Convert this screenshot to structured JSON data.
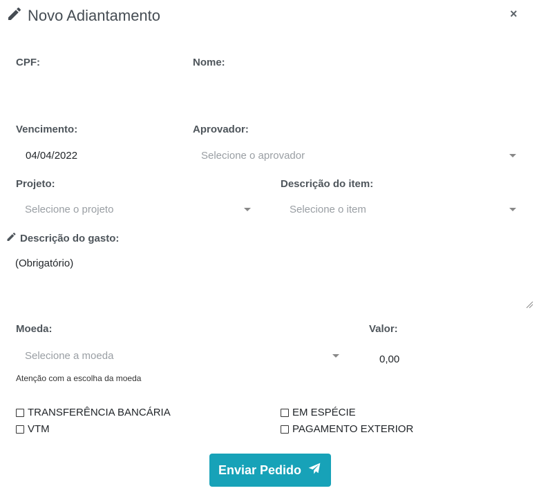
{
  "modal": {
    "title": "Novo Adiantamento",
    "close_label": "×"
  },
  "form": {
    "cpf_label": "CPF:",
    "nome_label": "Nome:",
    "vencimento_label": "Vencimento:",
    "vencimento_value": "04/04/2022",
    "aprovador_label": "Aprovador:",
    "aprovador_placeholder": "Selecione o aprovador",
    "projeto_label": "Projeto:",
    "projeto_placeholder": "Selecione o projeto",
    "item_label": "Descrição do item:",
    "item_placeholder": "Selecione o item",
    "gasto_label": "Descrição do gasto:",
    "gasto_placeholder": "(Obrigatório)",
    "moeda_label": "Moeda:",
    "moeda_placeholder": "Selecione a moeda",
    "moeda_hint": "Atenção com a escolha da moeda",
    "valor_label": "Valor:",
    "valor_value": "0,00"
  },
  "payment_options": [
    {
      "label": "TRANSFERÊNCIA BANCÁRIA",
      "checked": false
    },
    {
      "label": "EM ESPÉCIE",
      "checked": false
    },
    {
      "label": "VTM",
      "checked": false
    },
    {
      "label": "PAGAMENTO EXTERIOR",
      "checked": false
    }
  ],
  "submit": {
    "label": "Enviar Pedido"
  },
  "icons": {
    "title": "pencil-icon",
    "gasto": "pencil-icon",
    "submit": "paper-plane-icon",
    "dropdown": "caret-down-icon"
  },
  "colors": {
    "primary_button": "#17a2b8",
    "label": "#4e555b",
    "placeholder": "#999ea3"
  }
}
